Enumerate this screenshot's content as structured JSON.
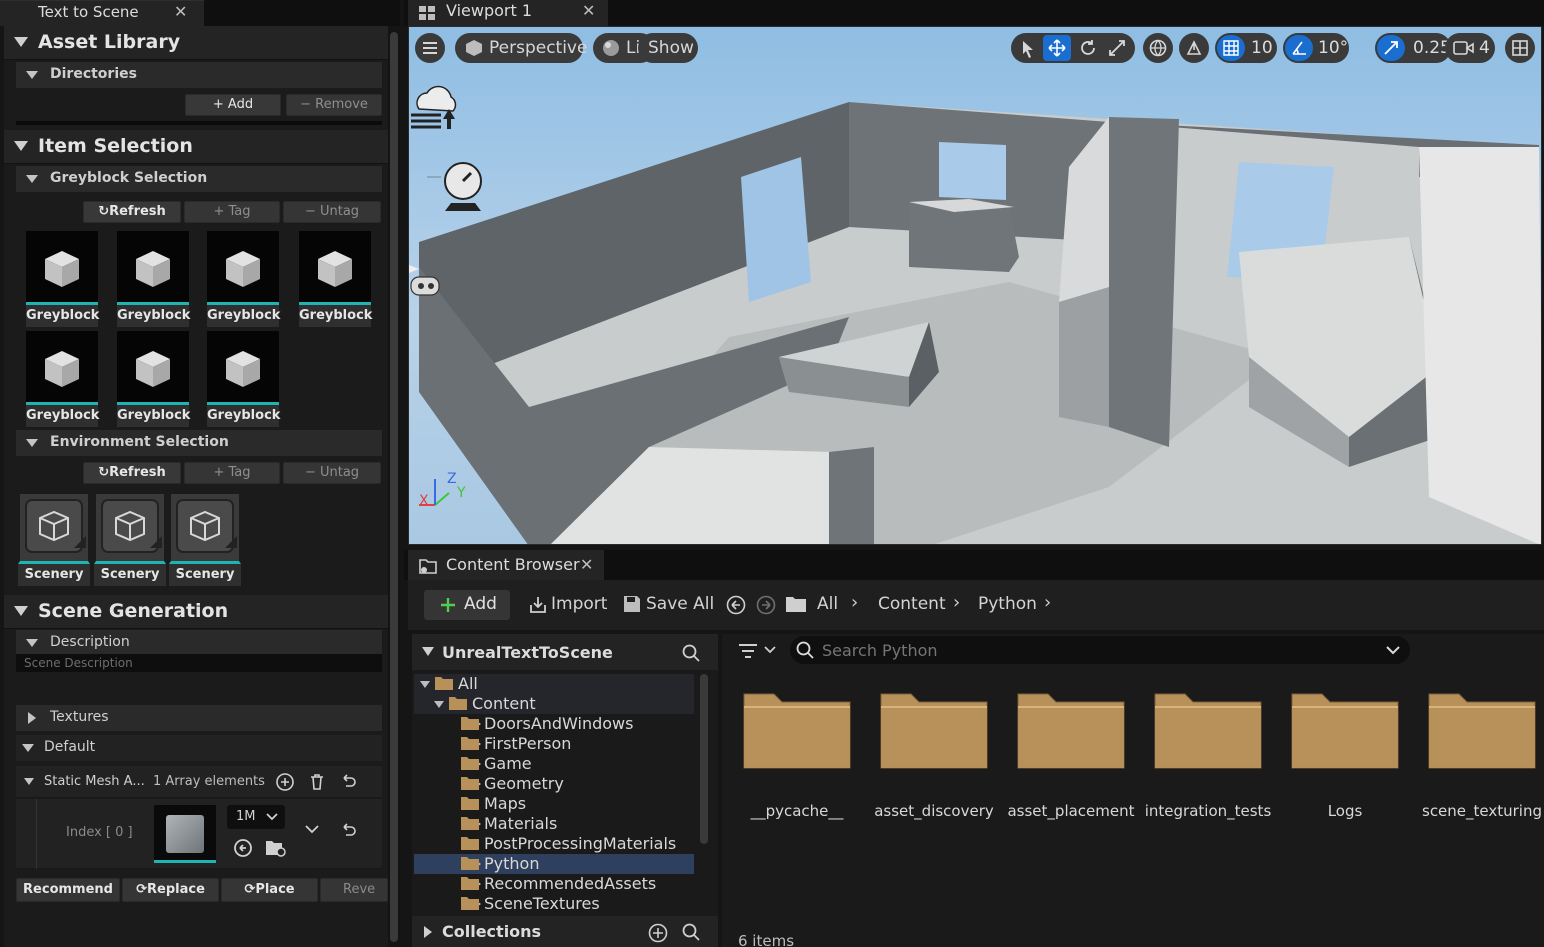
{
  "left_tab": {
    "title": "Text to Scene",
    "close": "✕"
  },
  "asset_library": {
    "title": "Asset Library",
    "directories": {
      "title": "Directories",
      "add": "+ Add",
      "remove": "− Remove"
    }
  },
  "item_selection": {
    "title": "Item Selection",
    "greyblock": {
      "title": "Greyblock Selection",
      "refresh": "Refresh",
      "tag": "+ Tag",
      "untag": "− Untag",
      "items": [
        "Greyblock",
        "Greyblock",
        "Greyblock",
        "Greyblock",
        "Greyblock",
        "Greyblock",
        "Greyblock"
      ]
    },
    "environment": {
      "title": "Environment Selection",
      "refresh": "Refresh",
      "tag": "+ Tag",
      "untag": "− Untag",
      "items": [
        "Scenery",
        "Scenery",
        "Scenery"
      ]
    }
  },
  "scene_generation": {
    "title": "Scene Generation",
    "description": {
      "title": "Description",
      "placeholder": "Scene Description"
    },
    "textures": "Textures",
    "default": "Default",
    "static_mesh": {
      "label": "Static Mesh A...",
      "count": "1 Array elements"
    },
    "index": {
      "label": "Index [ 0 ]",
      "dropdown": "1M"
    },
    "buttons": {
      "recommend": "Recommend",
      "replace": "Replace",
      "place": "Place",
      "revert": "Reve"
    }
  },
  "viewport_tab": {
    "title": "Viewport 1",
    "close": "✕"
  },
  "viewport": {
    "perspective": "Perspective",
    "lit": "Lit",
    "show": "Show",
    "grid_snap": "10",
    "rot_snap": "10°",
    "scale_snap": "0.25",
    "camera_speed": "4",
    "axis": {
      "x": "X",
      "y": "Y",
      "z": "Z"
    }
  },
  "content_browser_tab": {
    "title": "Content Browser",
    "close": "✕"
  },
  "content_browser": {
    "add": "Add",
    "import": "Import",
    "save_all": "Save All",
    "breadcrumb": [
      "All",
      "Content",
      "Python"
    ],
    "tree_title": "UnrealTextToScene",
    "tree": [
      {
        "label": "All",
        "depth": 0,
        "arrow": "down"
      },
      {
        "label": "Content",
        "depth": 1,
        "arrow": "down"
      },
      {
        "label": "DoorsAndWindows",
        "depth": 2,
        "arrow": "right"
      },
      {
        "label": "FirstPerson",
        "depth": 2,
        "arrow": "right"
      },
      {
        "label": "Game",
        "depth": 2,
        "arrow": "right"
      },
      {
        "label": "Geometry",
        "depth": 2,
        "arrow": "right"
      },
      {
        "label": "Maps",
        "depth": 2,
        "arrow": "none"
      },
      {
        "label": "Materials",
        "depth": 2,
        "arrow": "right"
      },
      {
        "label": "PostProcessingMaterials",
        "depth": 2,
        "arrow": "none"
      },
      {
        "label": "Python",
        "depth": 2,
        "arrow": "right"
      },
      {
        "label": "RecommendedAssets",
        "depth": 2,
        "arrow": "right"
      },
      {
        "label": "SceneTextures",
        "depth": 2,
        "arrow": "right"
      }
    ],
    "collections": "Collections",
    "search_placeholder": "Search Python",
    "folders": [
      "__pycache__",
      "asset_discovery",
      "asset_placement",
      "integration_tests",
      "Logs",
      "scene_texturing"
    ],
    "item_count": "6 items",
    "colors": {
      "folder": "#b8915a",
      "selection": "#2f3f5e",
      "accent": "#1fb4b1",
      "blue": "#1a6ed0"
    }
  }
}
